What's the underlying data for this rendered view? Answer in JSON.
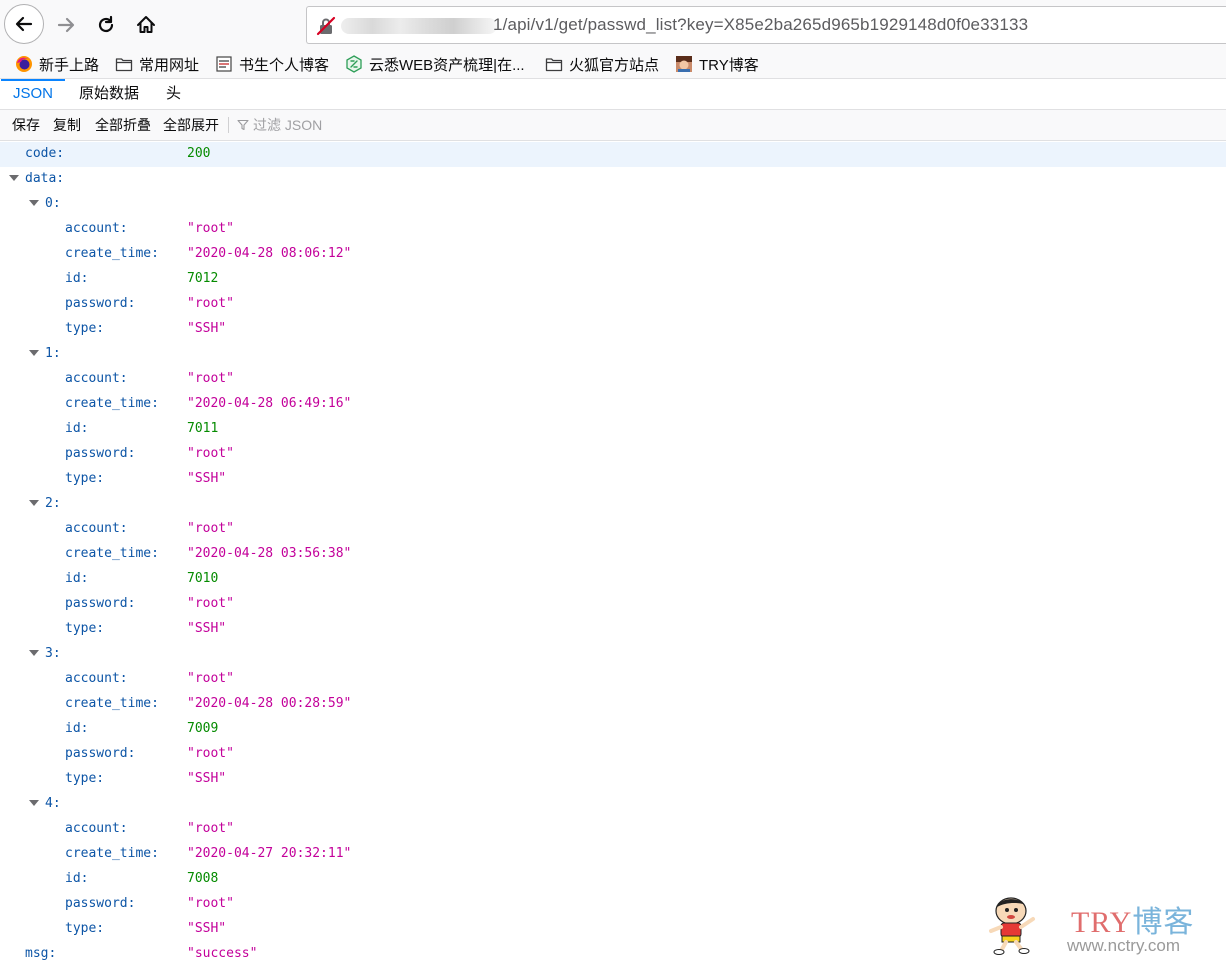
{
  "browser": {
    "url_visible": "1/api/v1/get/passwd_list?key=X85e2ba265d965b1929148d0f0e33133"
  },
  "bookmarks": [
    {
      "label": "新手上路",
      "icon": "firefox-icon"
    },
    {
      "label": "常用网址",
      "icon": "folder-icon"
    },
    {
      "label": "书生个人博客",
      "icon": "blog-icon"
    },
    {
      "label": "云悉WEB资产梳理|在...",
      "icon": "yunxi-icon"
    },
    {
      "label": "火狐官方站点",
      "icon": "folder-icon"
    },
    {
      "label": "TRY博客",
      "icon": "avatar-icon"
    }
  ],
  "viewer_tabs": [
    "JSON",
    "原始数据",
    "头"
  ],
  "toolbar": {
    "save": "保存",
    "copy": "复制",
    "collapse_all": "全部折叠",
    "expand_all": "全部展开",
    "filter_placeholder": "过滤 JSON"
  },
  "json": {
    "code_key": "code:",
    "code_value": "200",
    "data_key": "data:",
    "items": [
      {
        "index": "0:",
        "account": "\"root\"",
        "create_time": "\"2020-04-28 08:06:12\"",
        "id": "7012",
        "password": "\"root\"",
        "type": "\"SSH\""
      },
      {
        "index": "1:",
        "account": "\"root\"",
        "create_time": "\"2020-04-28 06:49:16\"",
        "id": "7011",
        "password": "\"root\"",
        "type": "\"SSH\""
      },
      {
        "index": "2:",
        "account": "\"root\"",
        "create_time": "\"2020-04-28 03:56:38\"",
        "id": "7010",
        "password": "\"root\"",
        "type": "\"SSH\""
      },
      {
        "index": "3:",
        "account": "\"root\"",
        "create_time": "\"2020-04-28 00:28:59\"",
        "id": "7009",
        "password": "\"root\"",
        "type": "\"SSH\""
      },
      {
        "index": "4:",
        "account": "\"root\"",
        "create_time": "\"2020-04-27 20:32:11\"",
        "id": "7008",
        "password": "\"root\"",
        "type": "\"SSH\""
      }
    ],
    "field_labels": {
      "account": "account:",
      "create_time": "create_time:",
      "id": "id:",
      "password": "password:",
      "type": "type:"
    },
    "msg_key": "msg:",
    "msg_value": "\"success\""
  },
  "watermark": {
    "title_a": "TRY",
    "title_b": "博客",
    "url": "www.nctry.com"
  },
  "colors": {
    "key": "#0d55a6",
    "number": "#058b00",
    "string": "#c3009a",
    "accent": "#0a84ff"
  }
}
